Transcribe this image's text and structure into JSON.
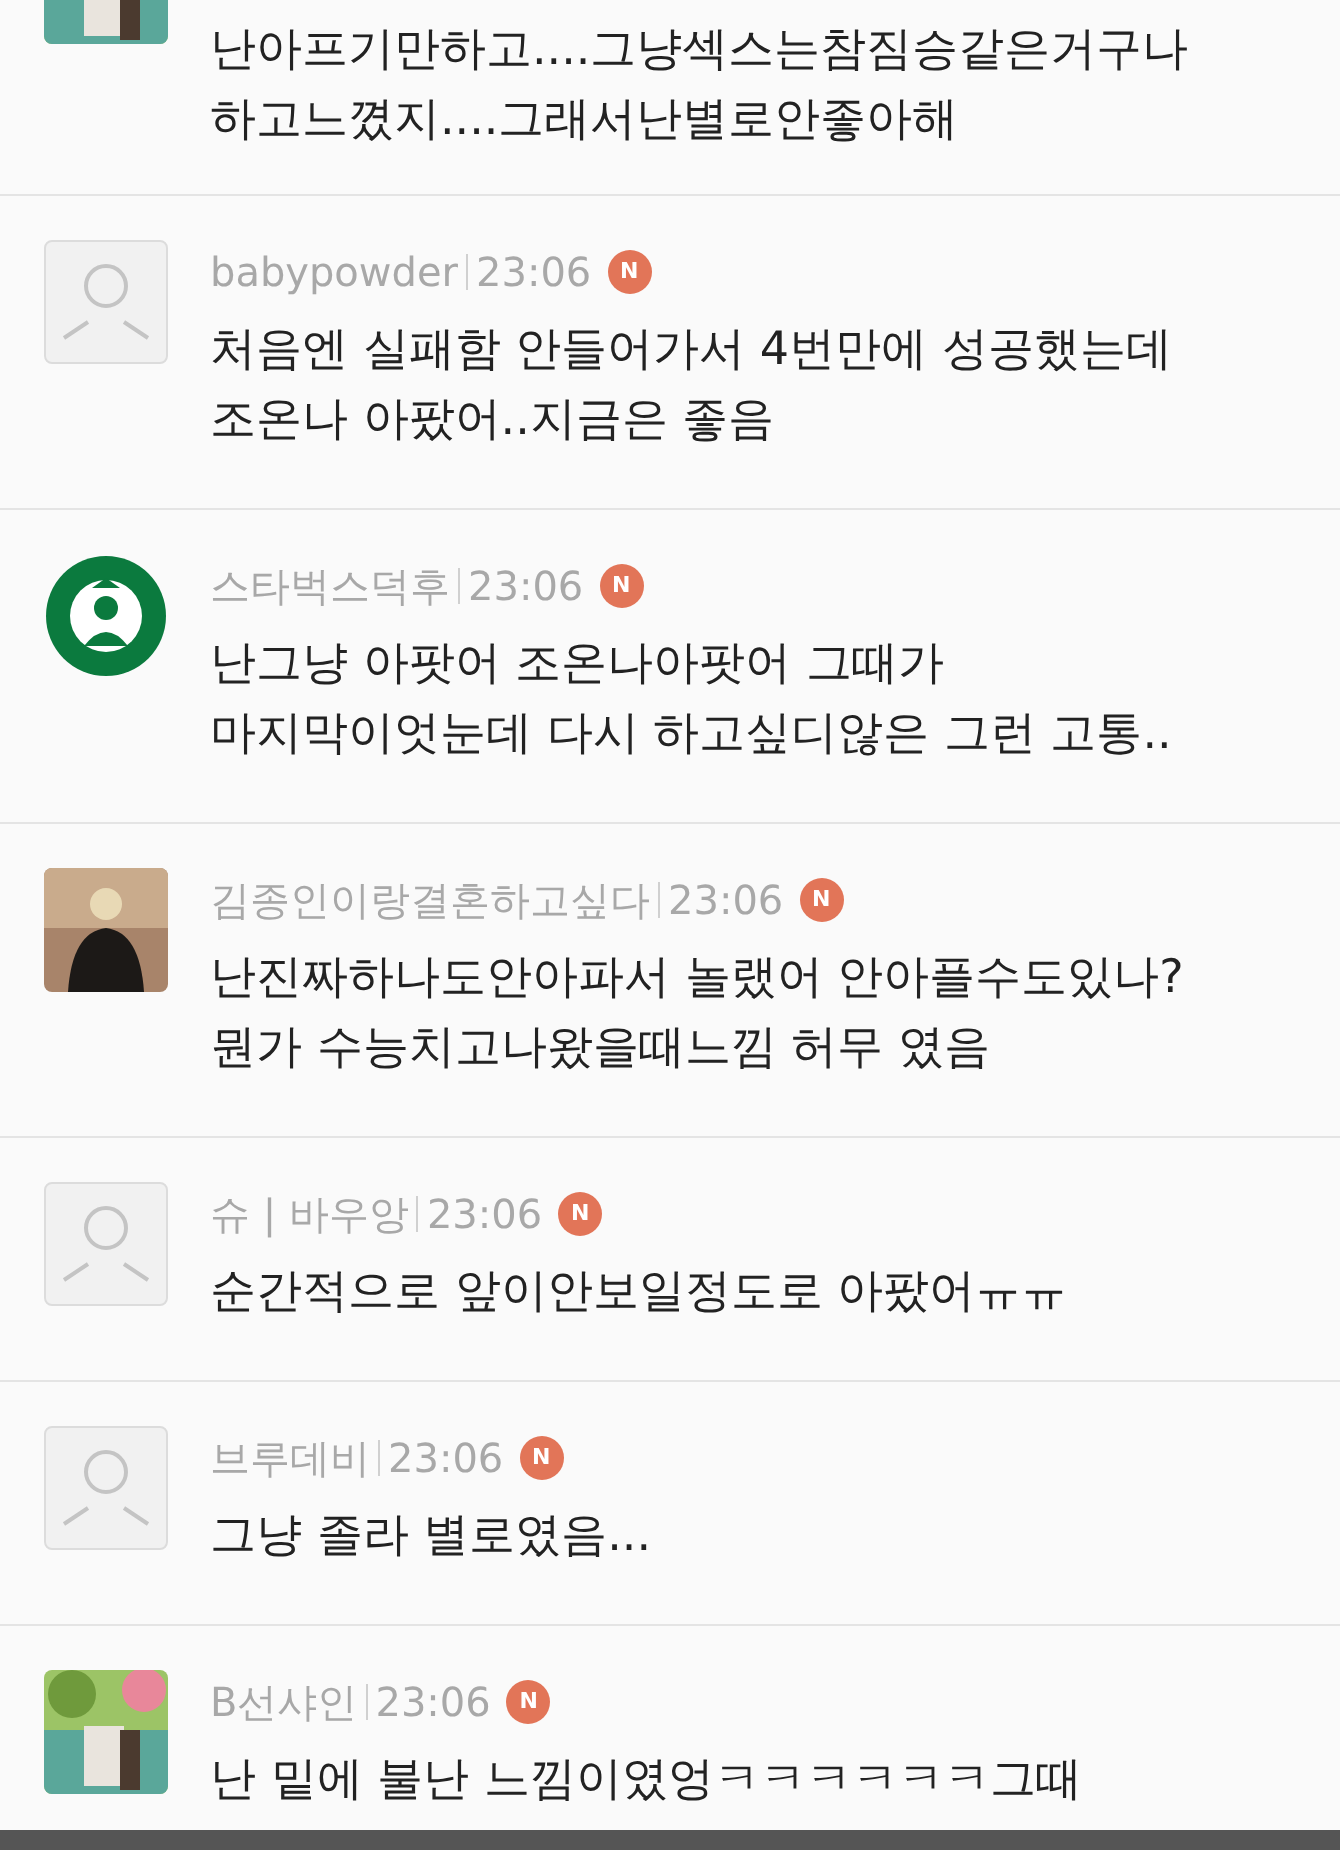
{
  "comments": [
    {
      "body": "난아프기만하고....그냥섹스는참짐승같은거구나\n하고느꼈지....그래서난별로안좋아해"
    },
    {
      "avatar": {
        "kind": "default"
      },
      "author": "babypowder",
      "time": "23:06",
      "new_badge": "N",
      "body": "처음엔 실패함 안들어가서 4번만에 성공했는데\n조온나 아팠어..지금은 좋음"
    },
    {
      "avatar": {
        "kind": "logo"
      },
      "author": "스타벅스덕후",
      "time": "23:06",
      "new_badge": "N",
      "body": "난그냥 아팟어 조온나아팟어 그때가\n마지막이엇눈데 다시 하고싶디않은 그런 고통.."
    },
    {
      "avatar": {
        "kind": "person"
      },
      "author": "김종인이랑결혼하고싶다",
      "time": "23:06",
      "new_badge": "N",
      "body": "난진짜하나도안아파서 놀랬어 안아플수도있나?\n뭔가 수능치고나왔을때느낌 허무 였음"
    },
    {
      "avatar": {
        "kind": "default"
      },
      "author": "슈 | 바우앙",
      "time": "23:06",
      "new_badge": "N",
      "body": "순간적으로 앞이안보일정도로 아팠어ㅠㅠ"
    },
    {
      "avatar": {
        "kind": "default"
      },
      "author": "브루데비",
      "time": "23:06",
      "new_badge": "N",
      "body": "그냥 졸라 별로였음..."
    },
    {
      "author": "B선샤인",
      "time": "23:06",
      "new_badge": "N",
      "body": "난 밑에 불난 느낌이였엉ㅋㅋㅋㅋㅋㅋ그때"
    }
  ]
}
